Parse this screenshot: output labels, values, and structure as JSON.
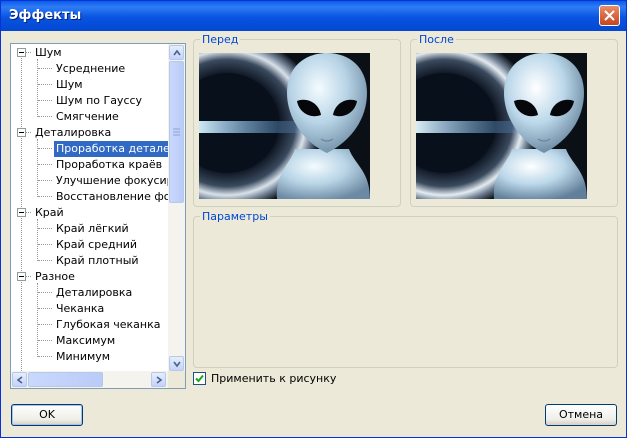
{
  "window": {
    "title": "Эффекты"
  },
  "tree": {
    "items": [
      {
        "label": "Шум",
        "level": 0,
        "expanded": true
      },
      {
        "label": "Усреднение",
        "level": 1
      },
      {
        "label": "Шум",
        "level": 1
      },
      {
        "label": "Шум по Гауссу",
        "level": 1
      },
      {
        "label": "Смягчение",
        "level": 1
      },
      {
        "label": "Деталировка",
        "level": 0,
        "expanded": true
      },
      {
        "label": "Проработка деталей",
        "level": 1,
        "selected": true
      },
      {
        "label": "Проработка краёв",
        "level": 1
      },
      {
        "label": "Улучшение фокусиров",
        "level": 1
      },
      {
        "label": "Восстановление фоку",
        "level": 1
      },
      {
        "label": "Край",
        "level": 0,
        "expanded": true
      },
      {
        "label": "Край лёгкий",
        "level": 1
      },
      {
        "label": "Край средний",
        "level": 1
      },
      {
        "label": "Край плотный",
        "level": 1
      },
      {
        "label": "Разное",
        "level": 0,
        "expanded": true
      },
      {
        "label": "Деталировка",
        "level": 1
      },
      {
        "label": "Чеканка",
        "level": 1
      },
      {
        "label": "Глубокая чеканка",
        "level": 1
      },
      {
        "label": "Максимум",
        "level": 1
      },
      {
        "label": "Минимум",
        "level": 1
      }
    ]
  },
  "preview": {
    "before_label": "Перед",
    "after_label": "После"
  },
  "params": {
    "label": "Параметры"
  },
  "apply": {
    "label": "Применить к рисунку",
    "checked": true
  },
  "buttons": {
    "ok": "OK",
    "cancel": "Отмена"
  },
  "colors": {
    "title_bar": "#0a5ce8",
    "selection": "#316ac5",
    "group_label": "#0046d5",
    "dialog_bg": "#ece9d8"
  },
  "icons": [
    "close-icon",
    "scroll-up-icon",
    "scroll-down-icon",
    "scroll-left-icon",
    "scroll-right-icon",
    "checkmark-icon",
    "collapse-icon"
  ]
}
